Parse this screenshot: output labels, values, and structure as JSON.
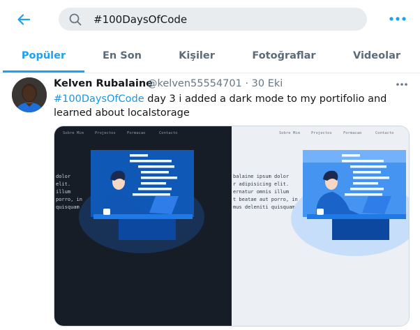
{
  "header": {
    "search_query": "#100DaysOfCode"
  },
  "tabs": [
    {
      "label": "Popüler",
      "active": true
    },
    {
      "label": "En Son",
      "active": false
    },
    {
      "label": "Kişiler",
      "active": false
    },
    {
      "label": "Fotoğraflar",
      "active": false
    },
    {
      "label": "Videolar",
      "active": false
    }
  ],
  "tweet": {
    "author_name": "Kelven Rubalaine",
    "handle": "@kelven55554701",
    "separator": "·",
    "date": "30 Eki",
    "hashtag": "#100DaysOfCode",
    "text": " day 3 i added a dark mode to my portifolio and learned about localstorage",
    "media": {
      "nav_items": [
        "Sobre Mim",
        "Projectos",
        "Formacao",
        "Contacto"
      ],
      "dark_text": [
        "dolor",
        "elit.",
        "illum",
        "porro, in",
        "quisquam"
      ],
      "light_text": [
        "balaine ipsum dolor",
        "r adipisicing elit.",
        "ernatur omnis illum",
        "t beatae aut porro, in",
        "mus deleniti quisquam"
      ]
    }
  },
  "colors": {
    "accent": "#1da1f2",
    "hashtag": "#1b95e0",
    "dark_panel": "#171d26",
    "light_panel": "#eceff3"
  }
}
